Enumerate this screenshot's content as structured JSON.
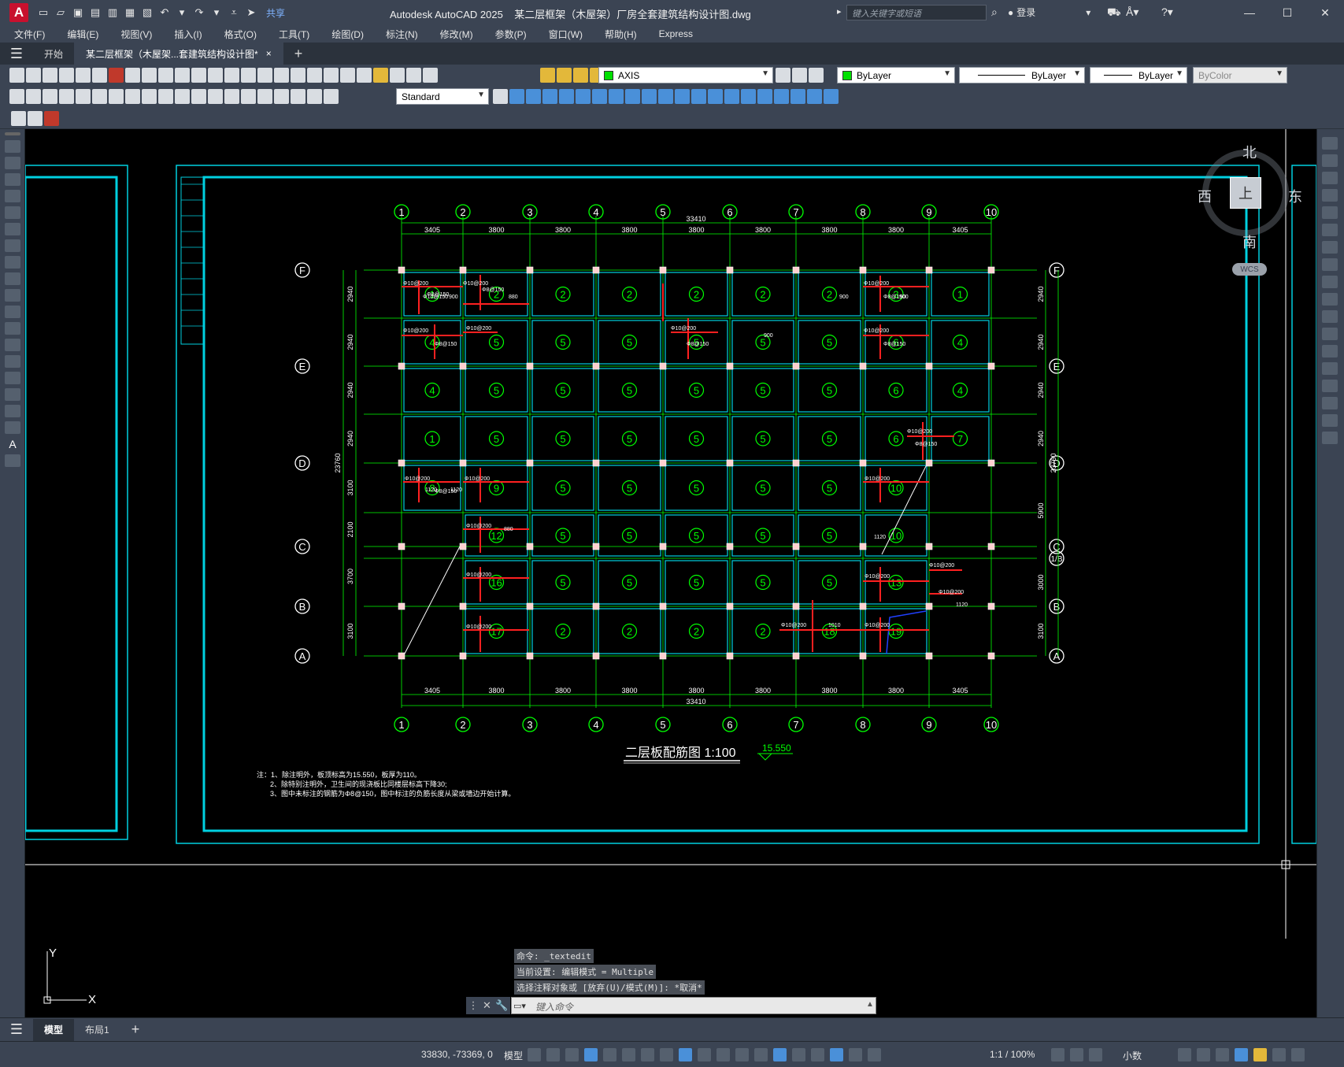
{
  "window": {
    "app_logo": "A",
    "app_title": "Autodesk AutoCAD 2025",
    "doc_title": "某二层框架（木屋架）厂房全套建筑结构设计图.dwg",
    "share_label": "共享",
    "search_placeholder": "键入关键字或短语",
    "login_label": "登录"
  },
  "menu": [
    "文件(F)",
    "编辑(E)",
    "视图(V)",
    "插入(I)",
    "格式(O)",
    "工具(T)",
    "绘图(D)",
    "标注(N)",
    "修改(M)",
    "参数(P)",
    "窗口(W)",
    "帮助(H)",
    "Express"
  ],
  "tabs": {
    "start": "开始",
    "doc": "某二层框架（木屋架...套建筑结构设计图*",
    "close": "×",
    "add": "+"
  },
  "toolbar": {
    "layer_name": "AXIS",
    "color": "ByLayer",
    "linetype": "ByLayer",
    "lineweight": "ByLayer",
    "plotstyle": "ByColor",
    "text_style": "Standard"
  },
  "viewcube": {
    "north": "北",
    "south": "南",
    "east": "东",
    "west": "西",
    "top": "上",
    "wcs": "WCS"
  },
  "drawing": {
    "col_labels": [
      "1",
      "2",
      "3",
      "4",
      "5",
      "6",
      "7",
      "8",
      "9",
      "10"
    ],
    "row_labels": [
      "F",
      "E",
      "D",
      "C",
      "B",
      "A"
    ],
    "extra_row": "1/B",
    "span_dims": [
      "3405",
      "3800",
      "3800",
      "3800",
      "3800",
      "3800",
      "3800",
      "3800",
      "3405"
    ],
    "total_width": "33410",
    "left_dims": [
      "2940",
      "2940",
      "2940",
      "2940",
      "3100",
      "2100",
      "3700",
      "3100"
    ],
    "right_dims": [
      "2940",
      "2940",
      "2940",
      "2940",
      "5900",
      "3000",
      "3100"
    ],
    "total_height": "23760",
    "slab_grid": [
      [
        "1",
        "2",
        "2",
        "2",
        "2",
        "2",
        "2",
        "3",
        "1"
      ],
      [
        "4",
        "5",
        "5",
        "5",
        "5",
        "5",
        "5",
        "6",
        "4"
      ],
      [
        "4",
        "5",
        "5",
        "5",
        "5",
        "5",
        "5",
        "6",
        "4"
      ],
      [
        "1",
        "5",
        "5",
        "5",
        "5",
        "5",
        "5",
        "6",
        "7"
      ],
      [
        "8",
        "9",
        "5",
        "5",
        "5",
        "5",
        "5",
        "10",
        ""
      ],
      [
        "",
        "12",
        "5",
        "5",
        "5",
        "5",
        "5",
        "10",
        ""
      ],
      [
        "",
        "16",
        "5",
        "5",
        "5",
        "5",
        "5",
        "13",
        ""
      ],
      [
        "",
        "17",
        "2",
        "2",
        "2",
        "2",
        "18",
        "19",
        ""
      ]
    ],
    "rebar_labels": [
      "Φ10@200",
      "Φ8@150",
      "Φ10@150",
      "880",
      "900",
      "1010",
      "1120"
    ],
    "title": "二层板配筋图 1:100",
    "elevation": "15.550",
    "notes": [
      "注：1、除注明外，板顶标高为15.550，板厚为110。",
      "2、除特别注明外，卫生间的现浇板比同楼层标高下降30;",
      "3、图中未标注的钢筋为Φ8@150，图中标注的负筋长度从梁或墙边开始计算。"
    ],
    "ucs_x": "X",
    "ucs_y": "Y"
  },
  "command": {
    "lines": [
      "命令: _textedit",
      "当前设置: 编辑模式 = Multiple",
      "选择注释对象或 [放弃(U)/模式(M)]: *取消*"
    ],
    "placeholder": "键入命令"
  },
  "layout_tabs": [
    "模型",
    "布局1"
  ],
  "status": {
    "coords": "33830, -73369, 0",
    "model": "模型",
    "scale": "1:1 / 100%",
    "units": "小数"
  },
  "colors": {
    "grid": "#00ff00",
    "beam": "#00d0e0",
    "rebar": "#ff2020",
    "column": "#ffffff",
    "text": "#ffffff"
  }
}
